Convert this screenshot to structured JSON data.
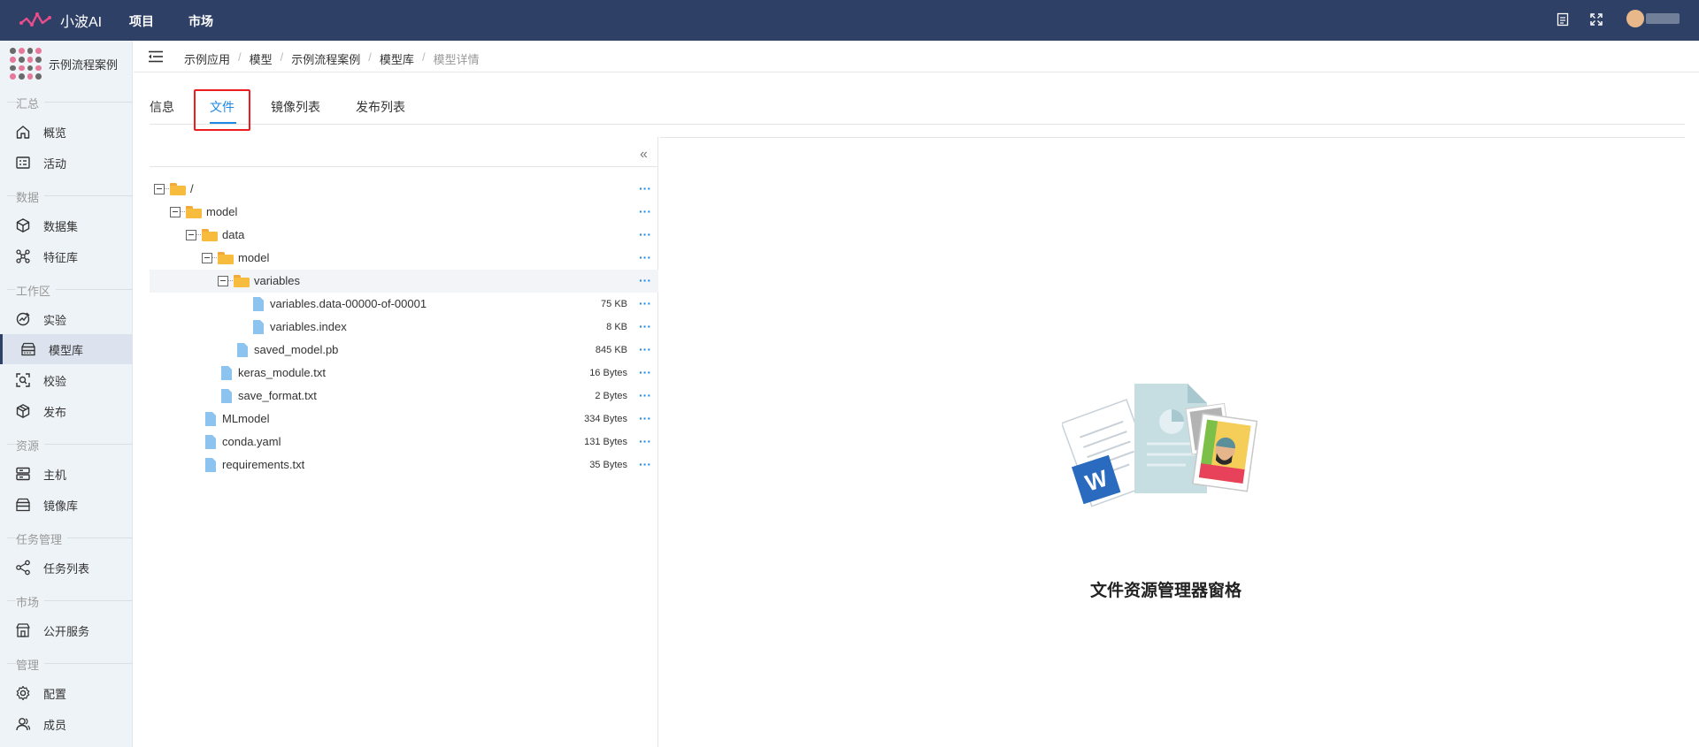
{
  "app": {
    "name": "小波AI"
  },
  "topbar": {
    "nav": [
      "项目",
      "市场"
    ]
  },
  "project": {
    "name": "示例流程案例"
  },
  "sidebar": {
    "sections": [
      {
        "title": "汇总",
        "items": [
          {
            "label": "概览",
            "icon": "home-icon"
          },
          {
            "label": "活动",
            "icon": "activity-icon"
          }
        ]
      },
      {
        "title": "数据",
        "items": [
          {
            "label": "数据集",
            "icon": "cube-icon"
          },
          {
            "label": "特征库",
            "icon": "nodes-icon"
          }
        ]
      },
      {
        "title": "工作区",
        "items": [
          {
            "label": "实验",
            "icon": "flask-icon"
          },
          {
            "label": "模型库",
            "icon": "stack-icon"
          },
          {
            "label": "校验",
            "icon": "scan-icon"
          },
          {
            "label": "发布",
            "icon": "box-icon"
          }
        ]
      },
      {
        "title": "资源",
        "items": [
          {
            "label": "主机",
            "icon": "server-icon"
          },
          {
            "label": "镜像库",
            "icon": "layers-icon"
          }
        ]
      },
      {
        "title": "任务管理",
        "items": [
          {
            "label": "任务列表",
            "icon": "share-icon"
          }
        ]
      },
      {
        "title": "市场",
        "items": [
          {
            "label": "公开服务",
            "icon": "shop-icon"
          }
        ]
      },
      {
        "title": "管理",
        "items": [
          {
            "label": "配置",
            "icon": "gear-icon"
          },
          {
            "label": "成员",
            "icon": "users-icon"
          }
        ]
      }
    ],
    "active": "模型库"
  },
  "breadcrumb": [
    "示例应用",
    "模型",
    "示例流程案例",
    "模型库",
    "模型详情"
  ],
  "tabs": [
    "信息",
    "文件",
    "镜像列表",
    "发布列表"
  ],
  "active_tab": "文件",
  "file_tree": [
    {
      "name": "/",
      "type": "folder",
      "size": ""
    },
    {
      "name": "model",
      "type": "folder",
      "size": ""
    },
    {
      "name": "data",
      "type": "folder",
      "size": ""
    },
    {
      "name": "model",
      "type": "folder",
      "size": ""
    },
    {
      "name": "variables",
      "type": "folder",
      "size": ""
    },
    {
      "name": "variables.data-00000-of-00001",
      "type": "file",
      "size": "75 KB"
    },
    {
      "name": "variables.index",
      "type": "file",
      "size": "8 KB"
    },
    {
      "name": "saved_model.pb",
      "type": "file",
      "size": "845 KB"
    },
    {
      "name": "keras_module.txt",
      "type": "file",
      "size": "16 Bytes"
    },
    {
      "name": "save_format.txt",
      "type": "file",
      "size": "2 Bytes"
    },
    {
      "name": "MLmodel",
      "type": "file",
      "size": "334 Bytes"
    },
    {
      "name": "conda.yaml",
      "type": "file",
      "size": "131 Bytes"
    },
    {
      "name": "requirements.txt",
      "type": "file",
      "size": "35 Bytes"
    }
  ],
  "more_label": "···",
  "collapse_label": "«",
  "empty": {
    "title": "文件资源管理器窗格"
  },
  "colors": {
    "topbar": "#2f4066",
    "accent": "#1e88e5",
    "sidebar": "#eef3f8",
    "highlight_box": "#ee1c1c"
  }
}
